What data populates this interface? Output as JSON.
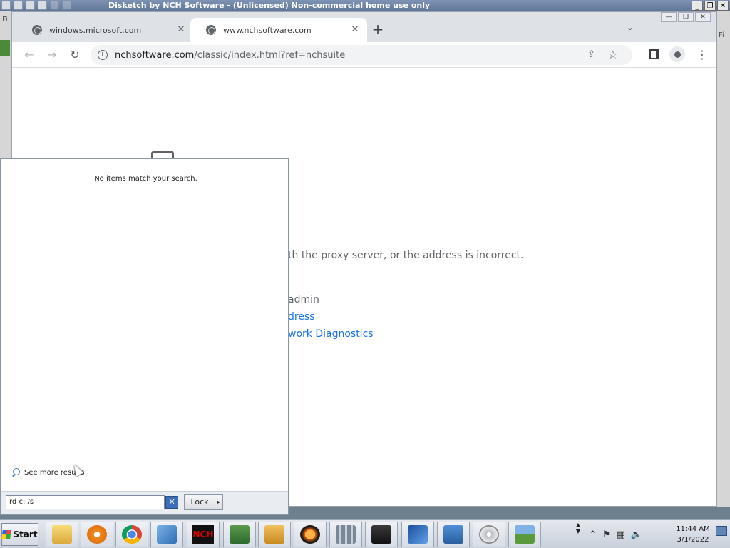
{
  "background_app": {
    "title": "Disketch by NCH Software - (Unlicensed) Non-commercial home use only",
    "left_strip_text": "Fi",
    "right_strip_text": "Fi"
  },
  "browser": {
    "tabs": [
      {
        "title": "windows.microsoft.com",
        "active": false
      },
      {
        "title": "www.nchsoftware.com",
        "active": true
      }
    ],
    "new_tab_label": "+",
    "tab_search_label": "⌄",
    "address": {
      "host": "nchsoftware.com",
      "path": "/classic/index.html?ref=nchsuite"
    },
    "nav": {
      "back": "←",
      "forward": "→",
      "reload": "↻",
      "menu": "⋮",
      "star": "☆",
      "share": "⇪"
    },
    "window_controls": [
      "—",
      "❐",
      "✕"
    ]
  },
  "page": {
    "error_line": "th the proxy server, or the address is incorrect.",
    "suggestion_1": "admin",
    "suggestion_2": "dress",
    "suggestion_3": "work Diagnostics"
  },
  "start_menu": {
    "no_items_text": "No items match your search.",
    "see_more_label": "See more results",
    "search_value": "rd c: /s",
    "clear_label": "✕",
    "lock_label": "Lock",
    "lock_arrow": "▸"
  },
  "taskbar": {
    "start_label": "Start",
    "nch_label": "NCH",
    "tray_icons": [
      "up-arrow-icon",
      "flag-icon",
      "network-icon",
      "volume-icon"
    ],
    "clock_time": "11:44 AM",
    "clock_date": "3/1/2022"
  },
  "colors": {
    "link": "#1a73e8",
    "taskbar": "#d7dde6",
    "clear_button": "#3c6fb8"
  }
}
